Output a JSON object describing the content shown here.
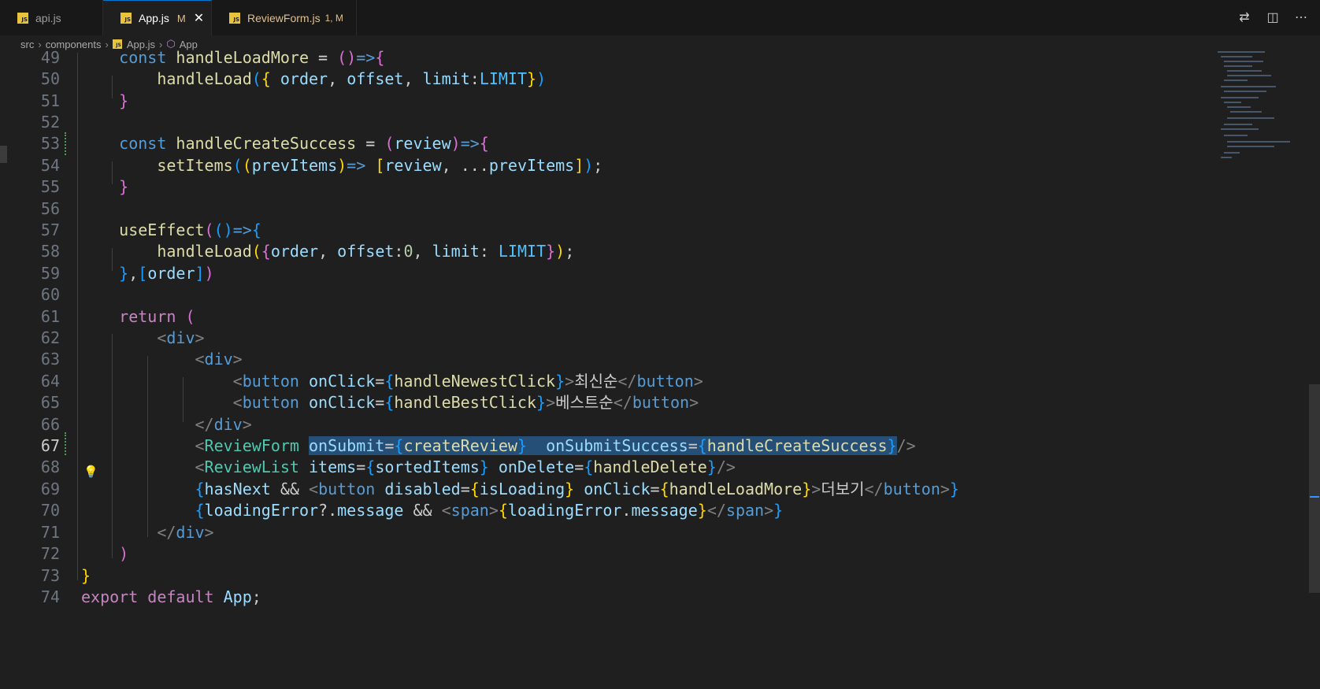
{
  "tabs": [
    {
      "name": "api.js",
      "active": false
    },
    {
      "name": "App.js",
      "status": "M",
      "active": true
    },
    {
      "name": "ReviewForm.js",
      "status": "1, M",
      "active": false
    }
  ],
  "breadcrumb": [
    "src",
    "components",
    "App.js",
    "App"
  ],
  "editor": {
    "line_numbers": [
      "49",
      "50",
      "51",
      "52",
      "53",
      "54",
      "55",
      "56",
      "57",
      "58",
      "59",
      "60",
      "61",
      "62",
      "63",
      "64",
      "65",
      "66",
      "67",
      "68",
      "69",
      "70",
      "71",
      "72",
      "73",
      "74"
    ],
    "current_line": "67",
    "code_lines": [
      "    const handleLoadMore = ()=>{",
      "        handleLoad({ order, offset, limit:LIMIT})",
      "    }",
      "",
      "    const handleCreateSuccess = (review)=>{",
      "        setItems((prevItems)=> [review, ...prevItems]);",
      "    }",
      "",
      "    useEffect(()=>{",
      "        handleLoad({order, offset:0, limit: LIMIT});",
      "    },[order])",
      "",
      "    return (",
      "        <div>",
      "            <div>",
      "                <button onClick={handleNewestClick}>최신순</button>",
      "                <button onClick={handleBestClick}>베스트순</button>",
      "            </div>",
      "            <ReviewForm onSubmit={createReview} onSubmitSuccess={handleCreateSuccess}/>",
      "            <ReviewList items={sortedItems} onDelete={handleDelete}/>",
      "            {hasNext && <button disabled={isLoading} onClick={handleLoadMore}>더보기</button>}",
      "            {loadingError?.message && <span>{loadingError.message}</span>}",
      "        </div>",
      "    )",
      "}",
      "export default App;"
    ]
  }
}
